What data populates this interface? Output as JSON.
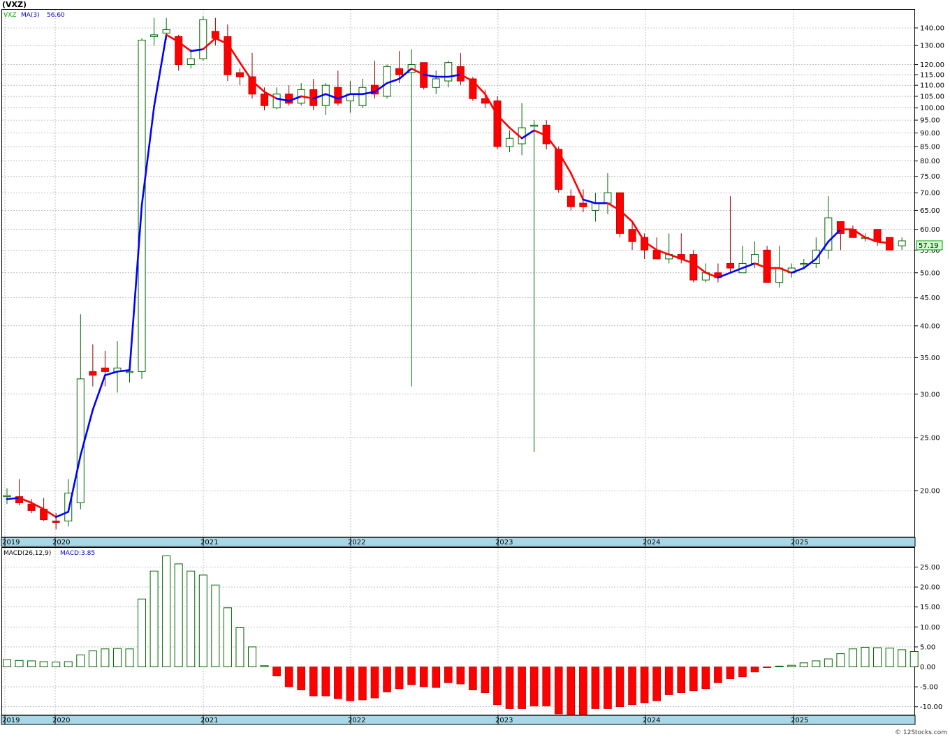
{
  "title": "(VXZ)",
  "footer": "© 12Stocks.com",
  "colors": {
    "up_candle": "#00aa00",
    "down_candle": "#ff0000",
    "ma_up": "#0000ff",
    "ma_down": "#ff0000",
    "axis_band": "#a8d8e8",
    "grid": "#999999",
    "price_badge": "#ccffcc"
  },
  "price_panel": {
    "legend_symbol": "VXZ",
    "legend_ma": "MA(3)",
    "legend_ma_value": "56.60",
    "last_price_label": "57.19",
    "y_tick_labels": [
      "140.00",
      "130.00",
      "120.00",
      "115.00",
      "110.00",
      "105.00",
      "100.00",
      "95.00",
      "90.00",
      "85.00",
      "80.00",
      "75.00",
      "70.00",
      "65.00",
      "60.00",
      "55.00",
      "50.00",
      "45.00",
      "40.00",
      "35.00",
      "30.00",
      "25.00",
      "20.00"
    ],
    "x_axis_labels": [
      "2019",
      "2020",
      "2021",
      "2022",
      "2023",
      "2024",
      "2025"
    ]
  },
  "macd_panel": {
    "legend_label": "MACD(26,12,9)",
    "legend_value": "MACD:3.85",
    "y_tick_labels": [
      "25.00",
      "20.00",
      "15.00",
      "10.00",
      "5.00",
      "0.00",
      "-5.00",
      "-10.00"
    ],
    "x_axis_labels": [
      "2019",
      "2020",
      "2021",
      "2022",
      "2023",
      "2024",
      "2025"
    ]
  },
  "chart_data": [
    {
      "type": "candlestick",
      "scale": "log",
      "ylim": [
        17,
        150
      ],
      "candles": [
        {
          "o": 19.5,
          "h": 20.2,
          "l": 18.9,
          "c": 19.6
        },
        {
          "o": 19.5,
          "h": 21.0,
          "l": 18.8,
          "c": 19.0
        },
        {
          "o": 18.9,
          "h": 19.3,
          "l": 18.2,
          "c": 18.4
        },
        {
          "o": 18.5,
          "h": 19.4,
          "l": 17.6,
          "c": 17.7
        },
        {
          "o": 17.6,
          "h": 18.2,
          "l": 17.0,
          "c": 17.5
        },
        {
          "o": 17.6,
          "h": 21.0,
          "l": 17.2,
          "c": 19.8
        },
        {
          "o": 19.0,
          "h": 42.0,
          "l": 18.5,
          "c": 32.0
        },
        {
          "o": 33.0,
          "h": 37.0,
          "l": 31.0,
          "c": 32.5
        },
        {
          "o": 33.5,
          "h": 36.0,
          "l": 31.0,
          "c": 33.0
        },
        {
          "o": 33.0,
          "h": 37.5,
          "l": 30.2,
          "c": 33.5
        },
        {
          "o": 33.0,
          "h": 34.0,
          "l": 31.5,
          "c": 33.0
        },
        {
          "o": 33.0,
          "h": 134,
          "l": 32.0,
          "c": 133
        },
        {
          "o": 135,
          "h": 146,
          "l": 130,
          "c": 136
        },
        {
          "o": 137,
          "h": 146,
          "l": 133,
          "c": 139
        },
        {
          "o": 135,
          "h": 136,
          "l": 117,
          "c": 120
        },
        {
          "o": 120,
          "h": 128,
          "l": 118,
          "c": 123
        },
        {
          "o": 123,
          "h": 147,
          "l": 122,
          "c": 145
        },
        {
          "o": 138,
          "h": 146,
          "l": 130,
          "c": 134
        },
        {
          "o": 135,
          "h": 142,
          "l": 112,
          "c": 115
        },
        {
          "o": 116,
          "h": 118,
          "l": 110,
          "c": 114
        },
        {
          "o": 114,
          "h": 126,
          "l": 104,
          "c": 106
        },
        {
          "o": 106,
          "h": 109,
          "l": 99,
          "c": 101
        },
        {
          "o": 100,
          "h": 109,
          "l": 99.5,
          "c": 106
        },
        {
          "o": 106,
          "h": 110,
          "l": 101,
          "c": 102
        },
        {
          "o": 102,
          "h": 111,
          "l": 101,
          "c": 108
        },
        {
          "o": 108,
          "h": 113,
          "l": 99,
          "c": 101
        },
        {
          "o": 101,
          "h": 111,
          "l": 97,
          "c": 110
        },
        {
          "o": 109,
          "h": 117,
          "l": 101,
          "c": 102
        },
        {
          "o": 103,
          "h": 112,
          "l": 98,
          "c": 106
        },
        {
          "o": 101,
          "h": 113,
          "l": 100,
          "c": 109
        },
        {
          "o": 110,
          "h": 122,
          "l": 104,
          "c": 106
        },
        {
          "o": 105,
          "h": 120,
          "l": 104,
          "c": 119
        },
        {
          "o": 118,
          "h": 127,
          "l": 111,
          "c": 115
        },
        {
          "o": 116,
          "h": 128,
          "l": 31.0,
          "c": 120
        },
        {
          "o": 121,
          "h": 121,
          "l": 108,
          "c": 109
        },
        {
          "o": 109,
          "h": 117,
          "l": 106,
          "c": 113
        },
        {
          "o": 112,
          "h": 122,
          "l": 109,
          "c": 121
        },
        {
          "o": 119,
          "h": 126,
          "l": 110,
          "c": 112
        },
        {
          "o": 113,
          "h": 114,
          "l": 103,
          "c": 104
        },
        {
          "o": 104,
          "h": 108,
          "l": 100,
          "c": 102
        },
        {
          "o": 103,
          "h": 105,
          "l": 84,
          "c": 85
        },
        {
          "o": 85,
          "h": 91,
          "l": 83,
          "c": 88
        },
        {
          "o": 86,
          "h": 102,
          "l": 82,
          "c": 92
        },
        {
          "o": 93,
          "h": 95,
          "l": 23.5,
          "c": 93
        },
        {
          "o": 93,
          "h": 95,
          "l": 84,
          "c": 86
        },
        {
          "o": 84,
          "h": 85,
          "l": 70,
          "c": 71
        },
        {
          "o": 69,
          "h": 71,
          "l": 65,
          "c": 66
        },
        {
          "o": 67,
          "h": 71,
          "l": 64.5,
          "c": 66
        },
        {
          "o": 65,
          "h": 70,
          "l": 62,
          "c": 67
        },
        {
          "o": 67,
          "h": 76,
          "l": 64,
          "c": 70
        },
        {
          "o": 70,
          "h": 70,
          "l": 58,
          "c": 59
        },
        {
          "o": 60,
          "h": 62,
          "l": 55,
          "c": 57
        },
        {
          "o": 58,
          "h": 59,
          "l": 53,
          "c": 55
        },
        {
          "o": 55,
          "h": 58,
          "l": 53,
          "c": 53
        },
        {
          "o": 53,
          "h": 59,
          "l": 52,
          "c": 54
        },
        {
          "o": 54,
          "h": 59,
          "l": 52,
          "c": 53
        },
        {
          "o": 54,
          "h": 55,
          "l": 48,
          "c": 48.5
        },
        {
          "o": 48.5,
          "h": 52,
          "l": 48,
          "c": 50
        },
        {
          "o": 50,
          "h": 52,
          "l": 48,
          "c": 49
        },
        {
          "o": 52,
          "h": 69,
          "l": 50,
          "c": 51
        },
        {
          "o": 50,
          "h": 56,
          "l": 50,
          "c": 52
        },
        {
          "o": 52,
          "h": 57,
          "l": 51,
          "c": 54
        },
        {
          "o": 55,
          "h": 56,
          "l": 48,
          "c": 48
        },
        {
          "o": 48,
          "h": 56,
          "l": 47,
          "c": 51
        },
        {
          "o": 50,
          "h": 52,
          "l": 49,
          "c": 51
        },
        {
          "o": 52,
          "h": 53,
          "l": 51,
          "c": 52
        },
        {
          "o": 52,
          "h": 58,
          "l": 51,
          "c": 55
        },
        {
          "o": 55,
          "h": 69,
          "l": 53,
          "c": 63
        },
        {
          "o": 62,
          "h": 62,
          "l": 55,
          "c": 59
        },
        {
          "o": 60,
          "h": 61,
          "l": 58,
          "c": 58
        },
        {
          "o": 58,
          "h": 59,
          "l": 57,
          "c": 58
        },
        {
          "o": 60,
          "h": 60,
          "l": 56,
          "c": 57
        },
        {
          "o": 58,
          "h": 58,
          "l": 55,
          "c": 55
        },
        {
          "o": 56,
          "h": 58,
          "l": 55,
          "c": 57.19
        }
      ],
      "ma3": [
        19.3,
        19.4,
        19.0,
        18.5,
        17.9,
        18.3,
        23.2,
        28.1,
        32.5,
        33.0,
        33.2,
        66.5,
        100.6,
        136,
        132,
        127,
        128,
        134,
        131,
        121,
        112,
        107,
        104,
        103,
        105,
        104,
        106,
        104,
        106,
        106,
        107,
        111,
        113,
        118,
        115,
        114,
        114,
        115,
        112,
        106,
        97,
        92,
        88,
        91,
        89,
        83,
        76,
        68,
        67,
        67,
        65,
        62,
        57,
        55,
        54,
        53,
        52,
        50,
        49,
        50,
        51,
        52,
        51,
        51,
        50,
        51,
        53,
        57,
        60,
        60,
        58,
        57,
        56.6
      ],
      "ma_colors": [
        "up",
        "up",
        "down",
        "down",
        "down",
        "up",
        "up",
        "up",
        "up",
        "up",
        "up",
        "up",
        "up",
        "up",
        "down",
        "down",
        "up",
        "down",
        "down",
        "down",
        "down",
        "down",
        "down",
        "up",
        "up",
        "down",
        "up",
        "up",
        "up",
        "up",
        "up",
        "up",
        "up",
        "up",
        "down",
        "up",
        "up",
        "up",
        "down",
        "down",
        "down",
        "down",
        "down",
        "up",
        "down",
        "down",
        "down",
        "down",
        "up",
        "up",
        "down",
        "down",
        "down",
        "down",
        "down",
        "down",
        "down",
        "down",
        "down",
        "up",
        "up",
        "up",
        "down",
        "down",
        "down",
        "up",
        "up",
        "up",
        "up",
        "down",
        "down",
        "down",
        "down",
        "down"
      ]
    },
    {
      "type": "bar",
      "title": "MACD(26,12,9)",
      "ylim": [
        -12,
        28
      ],
      "values": [
        1.8,
        1.6,
        1.5,
        1.3,
        1.2,
        1.3,
        3.0,
        4.0,
        4.5,
        4.6,
        4.5,
        17.0,
        24.0,
        27.8,
        25.8,
        24.0,
        23.0,
        20.5,
        14.8,
        9.8,
        5.0,
        0.3,
        -2.3,
        -5.0,
        -5.8,
        -7.3,
        -7.3,
        -8.0,
        -8.5,
        -8.3,
        -7.8,
        -6.3,
        -5.5,
        -4.5,
        -5.0,
        -5.2,
        -4.0,
        -4.3,
        -5.8,
        -6.5,
        -9.5,
        -10.5,
        -10.5,
        -9.8,
        -9.8,
        -11.8,
        -12.0,
        -12.0,
        -10.5,
        -10.5,
        -10.0,
        -9.5,
        -9.0,
        -8.5,
        -7.0,
        -6.5,
        -6.0,
        -5.5,
        -4.0,
        -3.0,
        -2.5,
        -1.3,
        -0.2,
        0.2,
        0.4,
        1.0,
        1.5,
        2.0,
        3.3,
        4.5,
        4.9,
        4.8,
        4.7,
        4.3,
        3.85
      ]
    }
  ]
}
